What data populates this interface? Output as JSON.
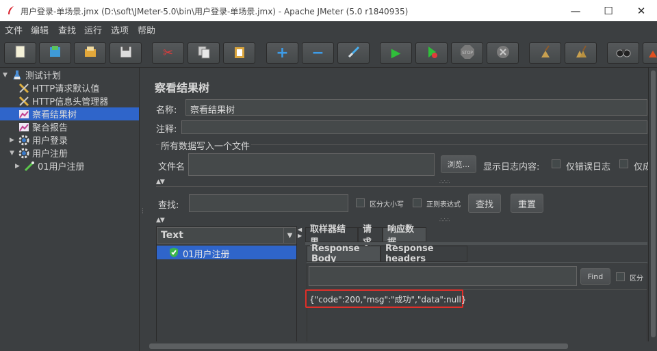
{
  "window": {
    "title": "用户登录-单场景.jmx (D:\\soft\\JMeter-5.0\\bin\\用户登录-单场景.jmx) - Apache JMeter (5.0 r1840935)",
    "minimize": "—",
    "maximize": "☐",
    "close": "✕"
  },
  "menu": [
    "文件",
    "编辑",
    "查找",
    "运行",
    "选项",
    "帮助"
  ],
  "toolbar": [
    {
      "name": "new-icon",
      "glyph": "▯"
    },
    {
      "name": "templates-icon",
      "glyph": "▣"
    },
    {
      "name": "open-icon",
      "glyph": "▤"
    },
    {
      "name": "save-icon",
      "glyph": "▦"
    },
    {
      "name": "cut-icon",
      "glyph": "✂"
    },
    {
      "name": "copy-icon",
      "glyph": "⧉"
    },
    {
      "name": "paste-icon",
      "glyph": "▥"
    },
    {
      "name": "expand-icon",
      "glyph": "+"
    },
    {
      "name": "collapse-icon",
      "glyph": "−"
    },
    {
      "name": "toggle-icon",
      "glyph": "⟋"
    },
    {
      "name": "start-icon",
      "glyph": "▶"
    },
    {
      "name": "start-no-pause-icon",
      "glyph": "▶"
    },
    {
      "name": "stop-icon",
      "glyph": "⬢"
    },
    {
      "name": "shutdown-icon",
      "glyph": "✖"
    },
    {
      "name": "clear-icon",
      "glyph": "⚘"
    },
    {
      "name": "clear-all-icon",
      "glyph": "⚘"
    },
    {
      "name": "search-icon",
      "glyph": "∞"
    },
    {
      "name": "reset-search-icon",
      "glyph": "⚘"
    }
  ],
  "tree": {
    "items": [
      {
        "label": "测试计划",
        "icon": "flask-icon",
        "arrow": "▼"
      },
      {
        "label": "HTTP请求默认值",
        "icon": "wrench-icon",
        "arrow": ""
      },
      {
        "label": "HTTP信息头管理器",
        "icon": "wrench-icon",
        "arrow": ""
      },
      {
        "label": "察看结果树",
        "icon": "chart-icon",
        "arrow": ""
      },
      {
        "label": "聚合报告",
        "icon": "chart-icon",
        "arrow": ""
      },
      {
        "label": "用户登录",
        "icon": "gear-icon",
        "arrow": "▶"
      },
      {
        "label": "用户注册",
        "icon": "gear-icon",
        "arrow": "▼"
      },
      {
        "label": "01用户注册",
        "icon": "pipette-icon",
        "arrow": "▶"
      }
    ]
  },
  "panel": {
    "title": "察看结果树",
    "name_label": "名称:",
    "name_value": "察看结果树",
    "comment_label": "注释:",
    "comment_value": "",
    "file_section": "所有数据写入一个文件",
    "file_label": "文件名",
    "file_value": "",
    "browse": "浏览...",
    "log_label": "显示日志内容:",
    "errors_only": "仅错误日志",
    "success_only": "仅成",
    "search_label": "查找:",
    "search_value": "",
    "case_label": "区分大小写",
    "regex_label": "正则表达式",
    "search_btn": "查找",
    "reset_btn": "重置"
  },
  "renderer": {
    "selected": "Text"
  },
  "results": [
    {
      "label": "01用户注册",
      "status": "success"
    }
  ],
  "tabs": [
    "取样器结果",
    "请求",
    "响应数据"
  ],
  "subtabs": [
    "Response Body",
    "Response headers"
  ],
  "find": {
    "value": "",
    "button": "Find",
    "case_label": "区分"
  },
  "response_body": "{\"code\":200,\"msg\":\"成功\",\"data\":null}",
  "colors": {
    "background": "#3c3f41",
    "selection": "#2f65ca",
    "highlight": "#e0302a",
    "success": "#3bb54a"
  }
}
